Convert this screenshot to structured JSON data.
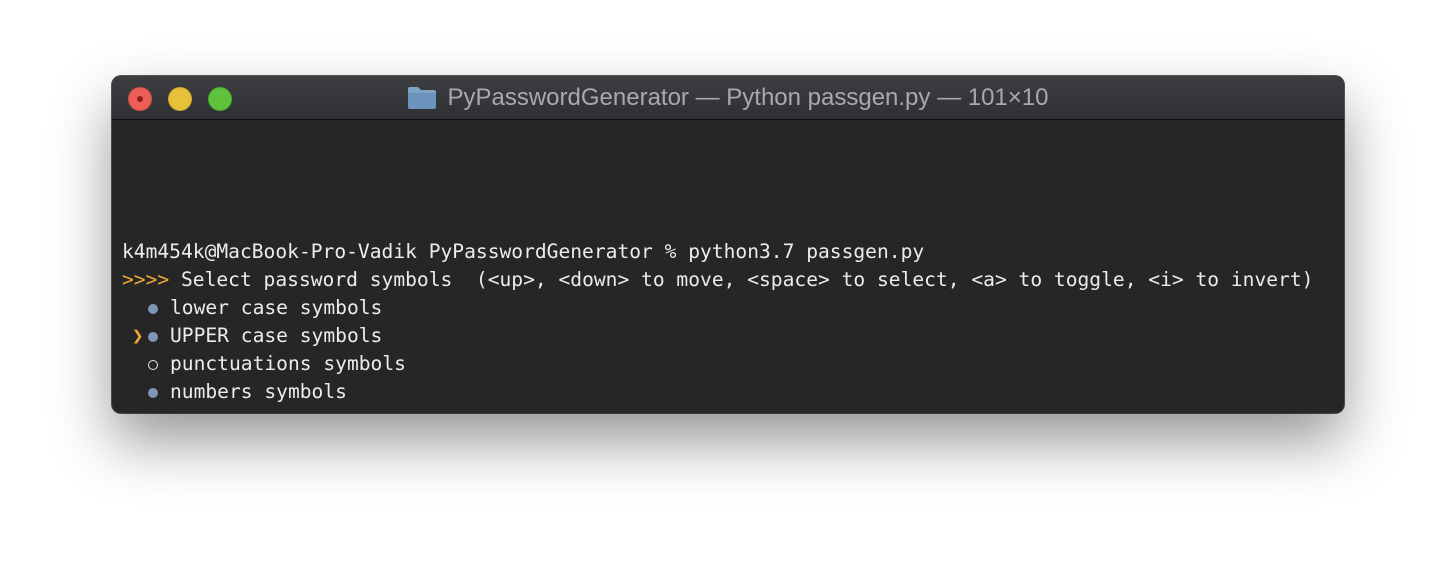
{
  "window": {
    "title": "PyPasswordGenerator — Python passgen.py — 101×10",
    "traffic_lights": [
      "close",
      "minimize",
      "zoom"
    ],
    "title_icon": "folder-icon"
  },
  "terminal": {
    "prompt_line": "k4m454k@MacBook-Pro-Vadik PyPasswordGenerator % python3.7 passgen.py",
    "question_marker": ">>>>",
    "question_text": " Select password symbols  (<up>, <down> to move, <space> to select, <a> to toggle, <i> to invert)",
    "pointer": "❯",
    "options": [
      {
        "label": "lower case symbols",
        "selected": true,
        "focused": false
      },
      {
        "label": "UPPER case symbols",
        "selected": true,
        "focused": true
      },
      {
        "label": "punctuations symbols",
        "selected": false,
        "focused": false
      },
      {
        "label": "numbers symbols",
        "selected": true,
        "focused": false
      }
    ]
  },
  "colors": {
    "accent": "#f3a937",
    "bullet_selected": "#7e96b7",
    "background": "#262626",
    "text": "#ececec"
  }
}
